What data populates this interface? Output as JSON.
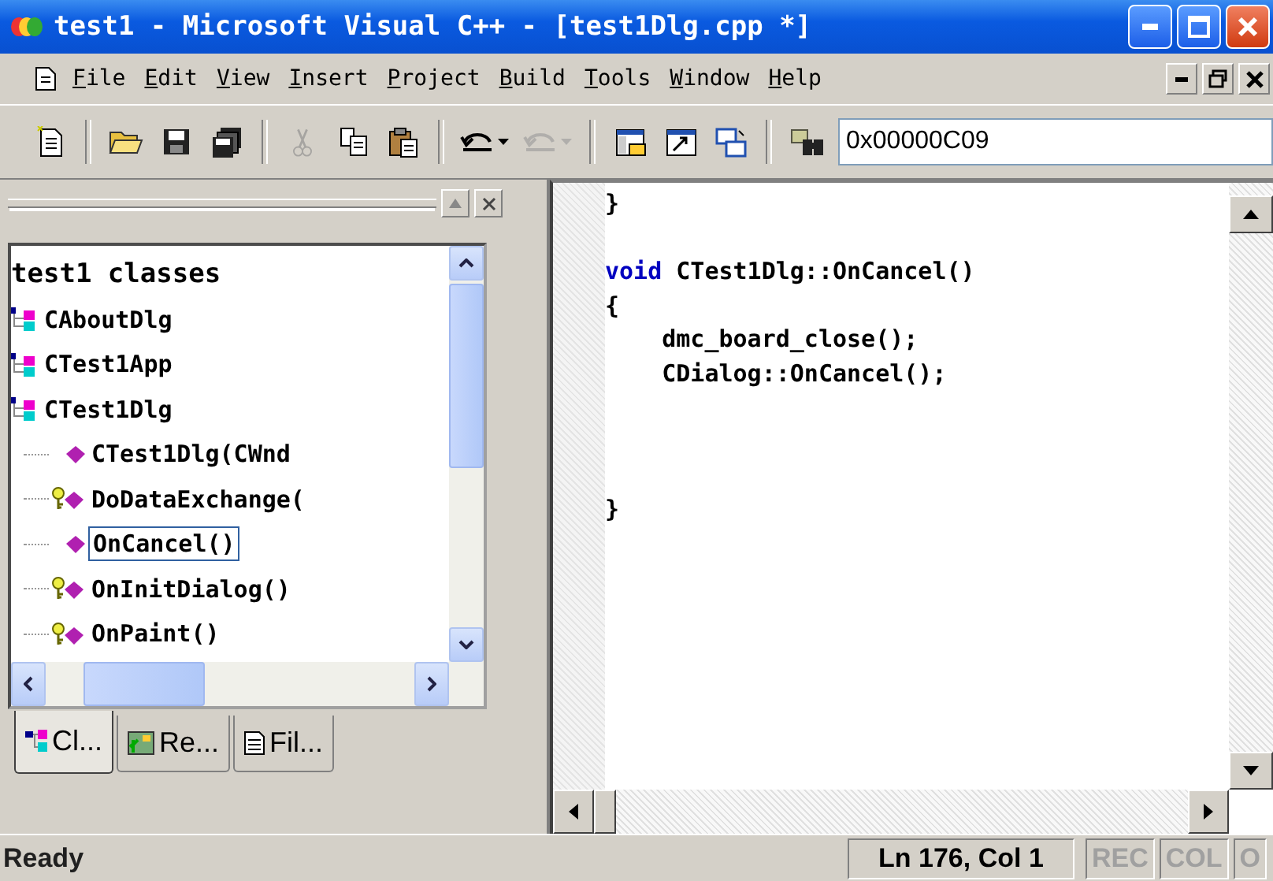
{
  "window": {
    "title": "test1 - Microsoft Visual C++ - [test1Dlg.cpp *]"
  },
  "menu": [
    "File",
    "Edit",
    "View",
    "Insert",
    "Project",
    "Build",
    "Tools",
    "Window",
    "Help"
  ],
  "toolbar": {
    "buttons": [
      {
        "kind": "new",
        "disabled": false
      },
      {
        "kind": "open",
        "disabled": false
      },
      {
        "kind": "save",
        "disabled": false
      },
      {
        "kind": "saveall",
        "disabled": false
      },
      {
        "kind": "cut",
        "disabled": true
      },
      {
        "kind": "copy",
        "disabled": false
      },
      {
        "kind": "paste",
        "disabled": false
      },
      {
        "kind": "undo",
        "disabled": false
      },
      {
        "kind": "redo",
        "disabled": true
      },
      {
        "kind": "workspace",
        "disabled": false
      },
      {
        "kind": "output",
        "disabled": false
      },
      {
        "kind": "windows",
        "disabled": false
      },
      {
        "kind": "find",
        "disabled": false
      }
    ],
    "find_value": "0x00000C09"
  },
  "workspace": {
    "root": "test1 classes",
    "classes": [
      {
        "name": "CAboutDlg"
      },
      {
        "name": "CTest1App"
      },
      {
        "name": "CTest1Dlg",
        "children": [
          {
            "name": "CTest1Dlg(CWnd",
            "kind": "public",
            "selected": false
          },
          {
            "name": "DoDataExchange(",
            "kind": "protected",
            "selected": false
          },
          {
            "name": "OnCancel()",
            "kind": "public",
            "selected": true
          },
          {
            "name": "OnInitDialog()",
            "kind": "protected",
            "selected": false
          },
          {
            "name": "OnPaint()",
            "kind": "protected",
            "selected": false
          }
        ]
      }
    ],
    "tabs": [
      {
        "label": "Cl...",
        "kind": "class",
        "selected": true
      },
      {
        "label": "Re...",
        "kind": "resource",
        "selected": false
      },
      {
        "label": "Fil...",
        "kind": "file",
        "selected": false
      }
    ]
  },
  "editor": {
    "lines": [
      {
        "kind": "code",
        "text": "}"
      },
      {
        "kind": "blank"
      },
      {
        "kind": "code",
        "keyword": "void",
        "text": "CTest1Dlg::OnCancel()"
      },
      {
        "kind": "code",
        "text": "{"
      },
      {
        "kind": "code",
        "text": "    dmc_board_close();"
      },
      {
        "kind": "code",
        "text": "    CDialog::OnCancel();"
      },
      {
        "kind": "blank"
      },
      {
        "kind": "blank"
      },
      {
        "kind": "blank"
      },
      {
        "kind": "code",
        "text": "}"
      }
    ]
  },
  "status_bar": {
    "message": "Ready",
    "position": "Ln 176, Col 1",
    "indicators": [
      {
        "label": "REC",
        "disabled": true
      },
      {
        "label": "COL",
        "disabled": true
      },
      {
        "label": "O",
        "disabled": true
      }
    ]
  }
}
